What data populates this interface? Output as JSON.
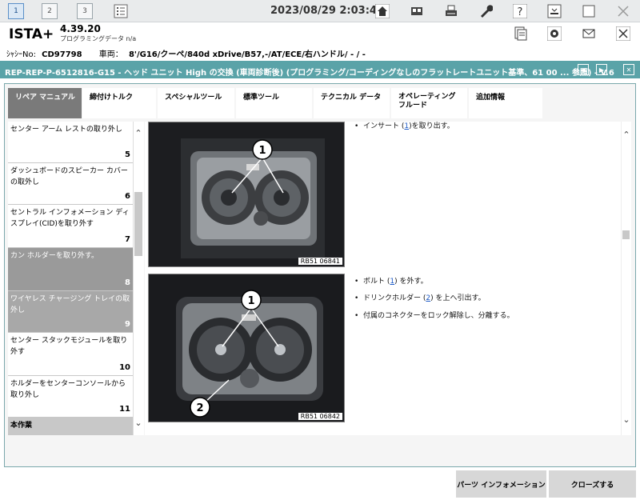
{
  "toolbar": {
    "pages": [
      "1",
      "2",
      "3"
    ],
    "datetime": "2023/08/29 2:03:43"
  },
  "app": {
    "name": "ISTA+",
    "version": "4.39.20",
    "subtitle": "プログラミングデータ   n/a"
  },
  "vehicle": {
    "chassis_label": "ｼｬｼｰNo:",
    "chassis_value": "CD97798",
    "vehicle_label": "車両：",
    "vehicle_value": "8'/G16/クーペ/840d xDrive/B57,-/AT/ECE/右ハンドル/ - / -"
  },
  "title": "REP-REP-P-6512816-G15 - ヘッド ユニット High の交換 (車両診断後) (プログラミング/コーディングなしのフラットレートユニット基準、61 00 ... 参照) - V.6",
  "tabs": [
    {
      "label": "リペア マニュアル"
    },
    {
      "label": "締付けトルク"
    },
    {
      "label": "スペシャルツール"
    },
    {
      "label": "標準ツール"
    },
    {
      "label": "テクニカル データ"
    },
    {
      "label": "オペレーティング\nフルード"
    },
    {
      "label": "追加情報"
    }
  ],
  "steps": [
    {
      "text": "センター アーム レストの取り外し",
      "num": "5"
    },
    {
      "text": "ダッシュボードのスピーカー カバーの取外し",
      "num": "6"
    },
    {
      "text": "セントラル インフォメーション ディスプレイ(CID)を取り外す",
      "num": "7"
    },
    {
      "text": "カン ホルダーを取り外す。",
      "num": "8"
    },
    {
      "text": "ワイヤレス チャージング トレイの取外し",
      "num": "9"
    },
    {
      "text": "センター スタックモジュールを取り外す",
      "num": "10"
    },
    {
      "text": "ホルダーをセンターコンソールから取り外し",
      "num": "11"
    },
    {
      "text": "本作業",
      "num": ""
    }
  ],
  "images": [
    {
      "caption": "RB51 06841",
      "callouts": [
        "1"
      ]
    },
    {
      "caption": "RB51 06842",
      "callouts": [
        "1",
        "2"
      ]
    }
  ],
  "instructions_top": {
    "pre": "インサート (",
    "link": "1",
    "post": ")を取り出す。"
  },
  "instructions": [
    {
      "pre": "ボルト (",
      "link": "1",
      "post": ") を外す。"
    },
    {
      "pre": "ドリンクホルダー (",
      "link": "2",
      "post": ") を上へ引出す。"
    },
    {
      "pre": "付属のコネクターをロック解除し、分離する。",
      "link": "",
      "post": ""
    }
  ],
  "buttons": {
    "parts": "パーツ インフォメーション",
    "close": "クローズする"
  }
}
